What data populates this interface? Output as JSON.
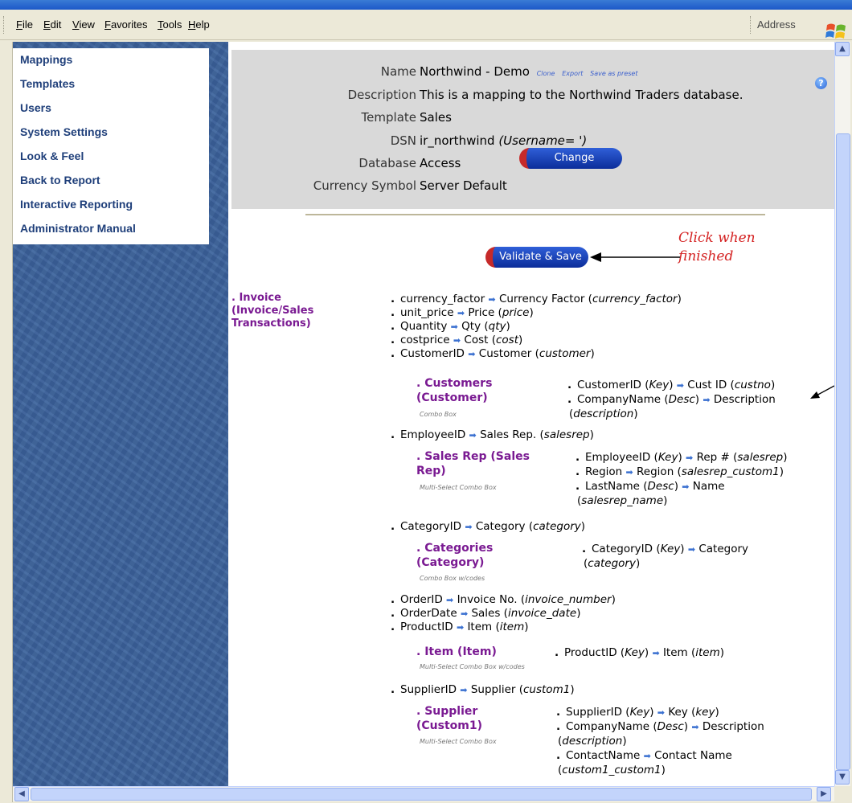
{
  "menu": [
    "File",
    "Edit",
    "View",
    "Favorites",
    "Tools",
    "Help"
  ],
  "address_label": "Address",
  "sidebar": [
    "Mappings",
    "Templates",
    "Users",
    "System Settings",
    "Look & Feel",
    "Back to Report",
    "Interactive Reporting",
    "Administrator Manual"
  ],
  "props": {
    "name_label": "Name",
    "name_value": "Northwind - Demo",
    "links": [
      "Clone",
      "Export",
      "Save as preset"
    ],
    "desc_label": "Description",
    "desc_value": "This is a mapping to the Northwind Traders database.",
    "template_label": "Template",
    "template_value": "Sales",
    "dsn_label": "DSN",
    "dsn_value": "ir_northwind",
    "dsn_user": "(Username= ')",
    "db_label": "Database",
    "db_value": "Access",
    "currency_label": "Currency Symbol",
    "currency_value": "Server Default"
  },
  "buttons": {
    "change": "Change",
    "validate": "Validate & Save"
  },
  "annotation": {
    "line1": "Click when",
    "line2": "finished"
  },
  "main_entity": {
    "title": "Invoice",
    "sub1": "(Invoice/Sales",
    "sub2": "Transactions)"
  },
  "fields": [
    {
      "src": "currency_factor",
      "dst": "Currency Factor",
      "col": "currency_factor"
    },
    {
      "src": "unit_price",
      "dst": "Price",
      "col": "price"
    },
    {
      "src": "Quantity",
      "dst": "Qty",
      "col": "qty"
    },
    {
      "src": "costprice",
      "dst": "Cost",
      "col": "cost"
    },
    {
      "src": "CustomerID",
      "dst": "Customer",
      "col": "customer"
    }
  ],
  "customers": {
    "title1": "Customers",
    "title2": "(Customer)",
    "type": "Combo Box",
    "l1_src": "CustomerID",
    "l1_key": "Key",
    "l1_dst": "Cust ID",
    "l1_col": "custno",
    "l2_src": "CompanyName",
    "l2_key": "Desc",
    "l2_dst": "Description",
    "l2_col": "description"
  },
  "employee": {
    "src": "EmployeeID",
    "dst": "Sales Rep.",
    "col": "salesrep"
  },
  "salesrep": {
    "title1": "Sales Rep (Sales",
    "title2": "Rep)",
    "type": "Multi-Select Combo Box",
    "l1_src": "EmployeeID",
    "l1_key": "Key",
    "l1_dst": "Rep #",
    "l1_col": "salesrep",
    "l2_src": "Region",
    "l2_dst": "Region",
    "l2_col": "salesrep_custom1",
    "l3_src": "LastName",
    "l3_key": "Desc",
    "l3_dst": "Name",
    "l3_col": "salesrep_name"
  },
  "category": {
    "src": "CategoryID",
    "dst": "Category",
    "col": "category"
  },
  "categories": {
    "title1": "Categories",
    "title2": "(Category)",
    "type": "Combo Box w/codes",
    "l1_src": "CategoryID",
    "l1_key": "Key",
    "l1_dst": "Category",
    "l1_col": "category"
  },
  "fields2": [
    {
      "src": "OrderID",
      "dst": "Invoice No.",
      "col": "invoice_number"
    },
    {
      "src": "OrderDate",
      "dst": "Sales",
      "col": "invoice_date"
    },
    {
      "src": "ProductID",
      "dst": "Item",
      "col": "item"
    }
  ],
  "item": {
    "title1": "Item (Item)",
    "type": "Multi-Select Combo Box w/codes",
    "l1_src": "ProductID",
    "l1_key": "Key",
    "l1_dst": "Item",
    "l1_col": "item"
  },
  "supplier": {
    "src": "SupplierID",
    "dst": "Supplier",
    "col": "custom1"
  },
  "supplier_lookup": {
    "title1": "Supplier",
    "title2": "(Custom1)",
    "type": "Multi-Select Combo Box",
    "l1_src": "SupplierID",
    "l1_key": "Key",
    "l1_dst": "Key",
    "l1_col": "key",
    "l2_src": "CompanyName",
    "l2_key": "Desc",
    "l2_dst": "Description",
    "l2_col": "description",
    "l3_src": "ContactName",
    "l3_dst": "Contact Name",
    "l3_col": "custom1_custom1"
  }
}
